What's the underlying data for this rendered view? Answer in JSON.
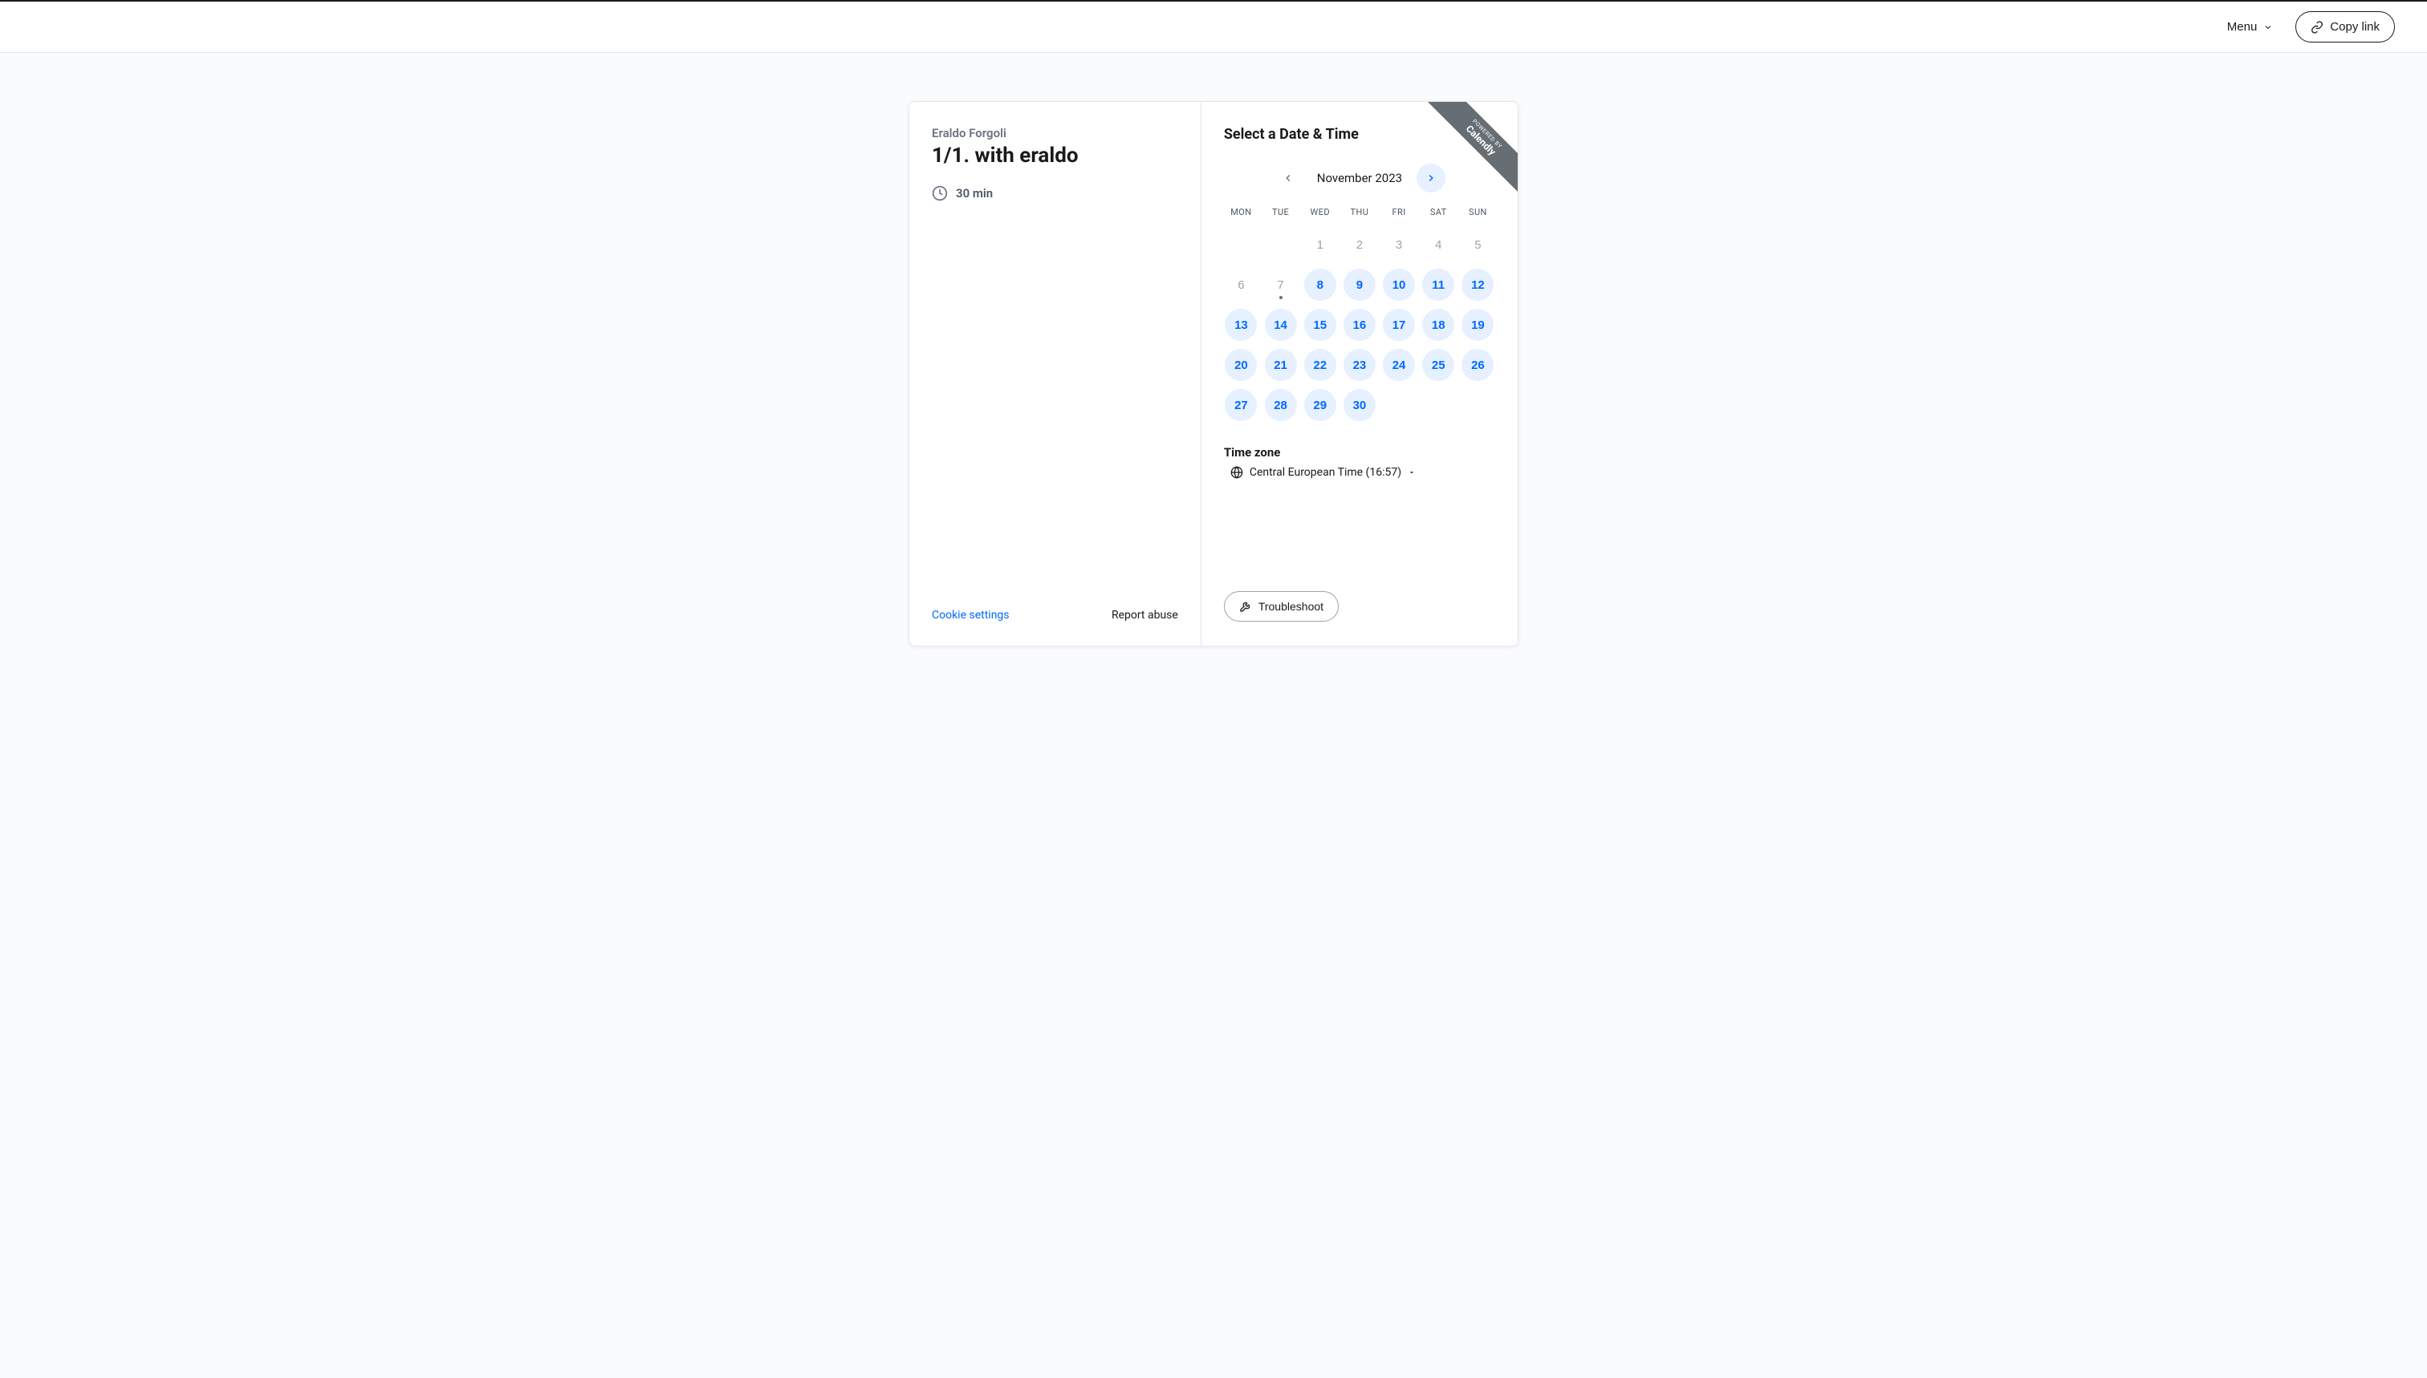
{
  "topbar": {
    "menu_label": "Menu",
    "copy_link_label": "Copy link"
  },
  "meeting": {
    "host_name": "Eraldo Forgoli",
    "title": "1/1. with eraldo",
    "duration_text": "30 min"
  },
  "left_footer": {
    "cookie_settings": "Cookie settings",
    "report_abuse": "Report abuse"
  },
  "right": {
    "heading": "Select a Date & Time",
    "month_label": "November 2023",
    "prev_enabled": false,
    "next_enabled": true,
    "dow": [
      "MON",
      "TUE",
      "WED",
      "THU",
      "FRI",
      "SAT",
      "SUN"
    ],
    "days": [
      {
        "n": "",
        "state": "blank"
      },
      {
        "n": "",
        "state": "blank"
      },
      {
        "n": "1",
        "state": "disabled"
      },
      {
        "n": "2",
        "state": "disabled"
      },
      {
        "n": "3",
        "state": "disabled"
      },
      {
        "n": "4",
        "state": "disabled"
      },
      {
        "n": "5",
        "state": "disabled"
      },
      {
        "n": "6",
        "state": "disabled"
      },
      {
        "n": "7",
        "state": "disabled",
        "today": true
      },
      {
        "n": "8",
        "state": "available"
      },
      {
        "n": "9",
        "state": "available"
      },
      {
        "n": "10",
        "state": "available"
      },
      {
        "n": "11",
        "state": "available"
      },
      {
        "n": "12",
        "state": "available"
      },
      {
        "n": "13",
        "state": "available"
      },
      {
        "n": "14",
        "state": "available"
      },
      {
        "n": "15",
        "state": "available"
      },
      {
        "n": "16",
        "state": "available"
      },
      {
        "n": "17",
        "state": "available"
      },
      {
        "n": "18",
        "state": "available"
      },
      {
        "n": "19",
        "state": "available"
      },
      {
        "n": "20",
        "state": "available"
      },
      {
        "n": "21",
        "state": "available"
      },
      {
        "n": "22",
        "state": "available"
      },
      {
        "n": "23",
        "state": "available"
      },
      {
        "n": "24",
        "state": "available"
      },
      {
        "n": "25",
        "state": "available"
      },
      {
        "n": "26",
        "state": "available"
      },
      {
        "n": "27",
        "state": "available"
      },
      {
        "n": "28",
        "state": "available"
      },
      {
        "n": "29",
        "state": "available"
      },
      {
        "n": "30",
        "state": "available"
      }
    ],
    "tz_heading": "Time zone",
    "tz_value": "Central European Time (16:57)",
    "troubleshoot_label": "Troubleshoot"
  },
  "ribbon": {
    "small": "POWERED BY",
    "big": "Calendly"
  }
}
